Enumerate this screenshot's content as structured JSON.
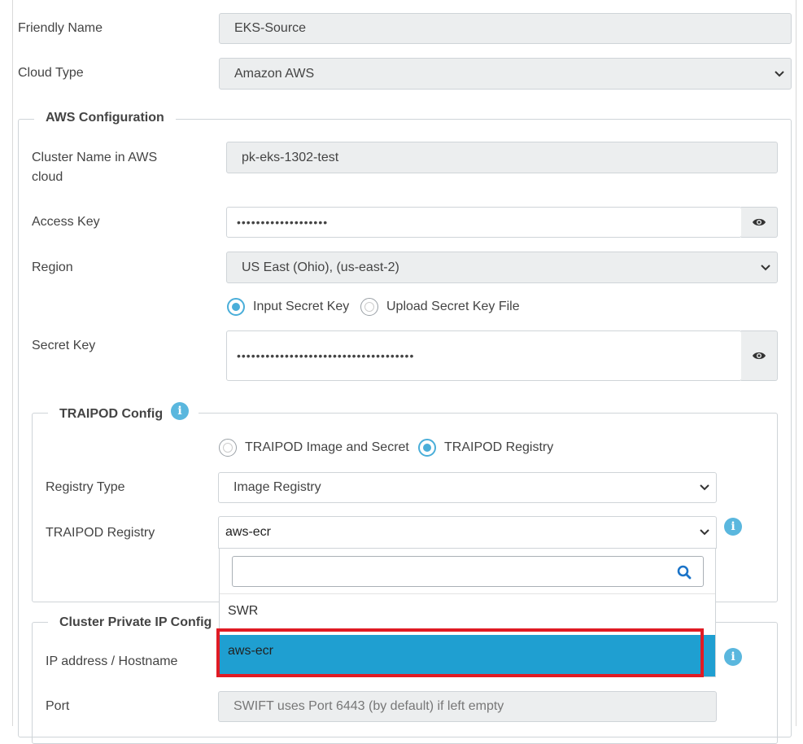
{
  "form": {
    "friendly_name_label": "Friendly Name",
    "friendly_name_value": "EKS-Source",
    "cloud_type_label": "Cloud Type",
    "cloud_type_value": "Amazon AWS"
  },
  "aws": {
    "legend": "AWS Configuration",
    "cluster_name_label_line1": "Cluster Name in AWS",
    "cluster_name_label_line2": "cloud",
    "cluster_name_value": "pk-eks-1302-test",
    "access_key_label": "Access Key",
    "access_key_value": "•••••••••••••••••••",
    "region_label": "Region",
    "region_value": "US East (Ohio), (us-east-2)",
    "radio_input_secret": "Input Secret Key",
    "radio_upload_secret": "Upload Secret Key File",
    "secret_key_label": "Secret Key",
    "secret_key_value": "•••••••••••••••••••••••••••••••••••••"
  },
  "traipod": {
    "legend": "TRAIPOD Config",
    "radio_image_secret": "TRAIPOD Image and Secret",
    "radio_registry": "TRAIPOD Registry",
    "registry_type_label": "Registry Type",
    "registry_type_value": "Image Registry",
    "registry_label": "TRAIPOD Registry",
    "registry_value": "aws-ecr"
  },
  "dropdown": {
    "search_value": "",
    "options": [
      "SWR",
      "aws-ecr"
    ],
    "selected": "aws-ecr"
  },
  "private_ip": {
    "legend": "Cluster Private IP Config",
    "ip_label": "IP address / Hostname",
    "port_label": "Port",
    "port_placeholder": "SWIFT uses Port 6443 (by default) if left empty"
  },
  "colors": {
    "accent": "#4aaed9",
    "highlight": "#1f9fd1",
    "outline": "#e01b24"
  }
}
